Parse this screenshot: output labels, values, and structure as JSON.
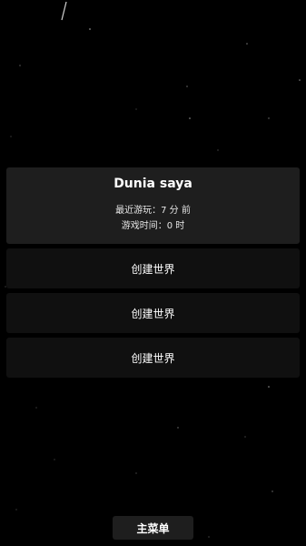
{
  "colors": {
    "background": "#000000",
    "card_active": "#1e1e1e",
    "card_empty": "#101010",
    "text": "#ffffff"
  },
  "worlds": {
    "slot1": {
      "name": "Dunia saya",
      "last_played": "最近游玩：7 分 前",
      "play_time": "游戏时间：0 时"
    },
    "slot2": {
      "label": "创建世界"
    },
    "slot3": {
      "label": "创建世界"
    },
    "slot4": {
      "label": "创建世界"
    }
  },
  "footer": {
    "main_menu_label": "主菜单"
  }
}
